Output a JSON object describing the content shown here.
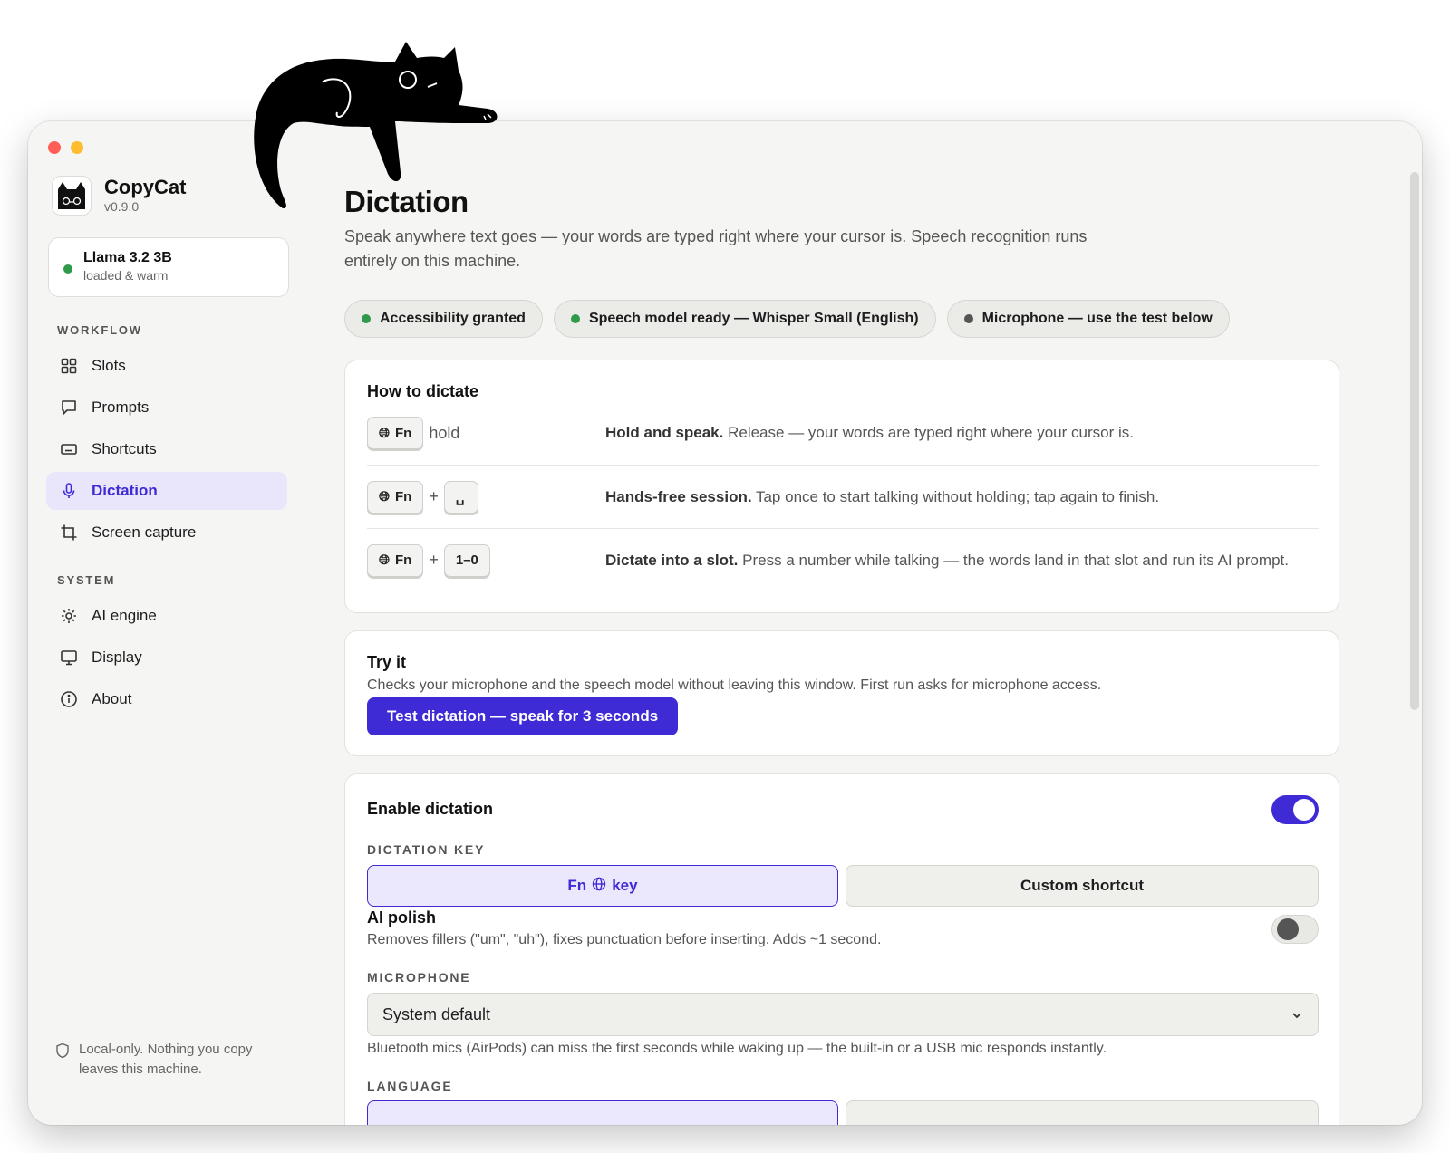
{
  "app": {
    "name": "CopyCat",
    "version": "v0.9.0"
  },
  "model": {
    "name": "Llama 3.2 3B",
    "state": "loaded & warm",
    "status_color": "#2e9a4a"
  },
  "sidebar": {
    "sections": [
      {
        "label": "WORKFLOW",
        "items": [
          {
            "label": "Slots",
            "icon": "grid-icon"
          },
          {
            "label": "Prompts",
            "icon": "chat-bubble-icon"
          },
          {
            "label": "Shortcuts",
            "icon": "keyboard-icon"
          },
          {
            "label": "Dictation",
            "icon": "microphone-icon",
            "active": true
          },
          {
            "label": "Screen capture",
            "icon": "crop-icon"
          }
        ]
      },
      {
        "label": "SYSTEM",
        "items": [
          {
            "label": "AI engine",
            "icon": "sparkle-icon"
          },
          {
            "label": "Display",
            "icon": "monitor-icon"
          },
          {
            "label": "About",
            "icon": "info-icon"
          }
        ]
      }
    ],
    "footer": "Local-only. Nothing you copy leaves this machine."
  },
  "page": {
    "title": "Dictation",
    "subtitle": "Speak anywhere text goes — your words are typed right where your cursor is. Speech recognition runs entirely on this machine."
  },
  "status_pills": [
    {
      "label": "Accessibility granted",
      "color": "#2e9a4a"
    },
    {
      "label": "Speech model ready — Whisper Small (English)",
      "color": "#2e9a4a"
    },
    {
      "label": "Microphone — use the test below",
      "color": "#555555"
    }
  ],
  "how_to": {
    "title": "How to dictate",
    "rows": [
      {
        "keys": [
          "Fn"
        ],
        "suffix": "hold",
        "bold": "Hold and speak.",
        "text": " Release — your words are typed right where your cursor is."
      },
      {
        "keys": [
          "Fn",
          "␣"
        ],
        "bold": "Hands-free session.",
        "text": " Tap once to start talking without holding; tap again to finish."
      },
      {
        "keys": [
          "Fn",
          "1–0"
        ],
        "bold": "Dictate into a slot.",
        "text": " Press a number while talking — the words land in that slot and run its AI prompt."
      }
    ],
    "plus": "+"
  },
  "try_it": {
    "title": "Try it",
    "subtitle": "Checks your microphone and the speech model without leaving this window. First run asks for microphone access.",
    "button": "Test dictation — speak for 3 seconds"
  },
  "settings": {
    "enable_label": "Enable dictation",
    "enable_on": true,
    "dictation_key_label": "DICTATION KEY",
    "key_options": [
      {
        "label_before": "Fn",
        "label_after": "key",
        "active": true
      },
      {
        "label": "Custom shortcut",
        "active": false
      }
    ],
    "polish_label": "AI polish",
    "polish_desc": "Removes fillers (\"um\", \"uh\"), fixes punctuation before inserting. Adds ~1 second.",
    "polish_on": false,
    "microphone_label": "MICROPHONE",
    "microphone_value": "System default",
    "microphone_help": "Bluetooth mics (AirPods) can miss the first seconds while waking up — the built-in or a USB mic responds instantly.",
    "language_label": "LANGUAGE"
  },
  "colors": {
    "accent": "#3f2bd6",
    "accent_soft": "#e9e6fb"
  }
}
